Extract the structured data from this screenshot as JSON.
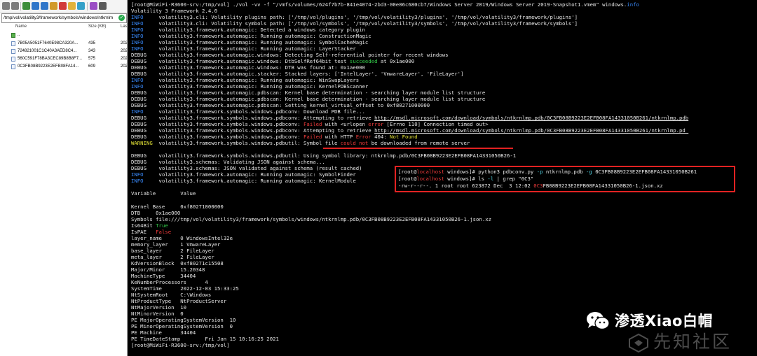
{
  "file_pane": {
    "path": "/tmp/vol/volatility3/framework/symbols/windows/ntkrnlm",
    "columns": {
      "name": "Name",
      "size": "Size (KB)",
      "last": "Las"
    },
    "files": [
      {
        "name": "..",
        "size": "",
        "last": ""
      },
      {
        "name": "7B05A5051F7640E98CA320A...",
        "size": "435",
        "last": "202"
      },
      {
        "name": "724821001C1C40A3AED8C4...",
        "size": "343",
        "last": "202"
      },
      {
        "name": "560C591F78BA3CEC89B8B8F7...",
        "size": "575",
        "last": "202"
      },
      {
        "name": "0C3FB08B9223E2EFB08FA14...",
        "size": "609",
        "last": "202"
      }
    ]
  },
  "terminal": {
    "lines": [
      [
        {
          "t": "[root@MiWiFi-R3600-srv:/tmp/vol] ./vol -vv -f \"/vmfs/volumes/624f7b7b-841e4074-2bd3-00e06c680cb7/Windows Server 2019/Windows Server 2019-Snapshot1.vmem\" windows."
        },
        {
          "t": "info",
          "c": "c-info"
        }
      ],
      [
        {
          "t": "Volatility 3 Framework 2.4.0"
        }
      ],
      [
        {
          "t": "INFO    ",
          "c": "c-info"
        },
        {
          "t": " volatility3.cli: Volatility plugins path: ['/tmp/vol/plugins', '/tmp/vol/volatility3/plugins', '/tmp/vol/volatility3/framework/plugins']"
        }
      ],
      [
        {
          "t": "INFO    ",
          "c": "c-info"
        },
        {
          "t": " volatility3.cli: Volatility symbols path: ['/tmp/vol/symbols', '/tmp/vol/volatility3/symbols', '/tmp/vol/volatility3/framework/symbols']"
        }
      ],
      [
        {
          "t": "INFO    ",
          "c": "c-info"
        },
        {
          "t": " volatility3.framework.automagic: Detected a windows category plugin"
        }
      ],
      [
        {
          "t": "INFO    ",
          "c": "c-info"
        },
        {
          "t": " volatility3.framework.automagic: Running automagic: ConstructionMagic"
        }
      ],
      [
        {
          "t": "INFO    ",
          "c": "c-info"
        },
        {
          "t": " volatility3.framework.automagic: Running automagic: SymbolCacheMagic"
        }
      ],
      [
        {
          "t": "INFO    ",
          "c": "c-info"
        },
        {
          "t": " volatility3.framework.automagic: Running automagic: LayerStacker"
        }
      ],
      [
        {
          "t": "DEBUG   "
        },
        {
          "t": " volatility3.framework.automagic.windows: Detecting Self-referential pointer for recent windows"
        }
      ],
      [
        {
          "t": "DEBUG   "
        },
        {
          "t": " volatility3.framework.automagic.windows: DtbSelfRef64bit test "
        },
        {
          "t": "succeeded",
          "c": "c-grn"
        },
        {
          "t": " at 0x1ae000"
        }
      ],
      [
        {
          "t": "DEBUG   "
        },
        {
          "t": " volatility3.framework.automagic.windows: DTB was found at: 0x1ae000"
        }
      ],
      [
        {
          "t": "DEBUG   "
        },
        {
          "t": " volatility3.framework.automagic.stacker: Stacked layers: ['IntelLayer', 'VmwareLayer', 'FileLayer']"
        }
      ],
      [
        {
          "t": "INFO    ",
          "c": "c-info"
        },
        {
          "t": " volatility3.framework.automagic: Running automagic: WinSwapLayers"
        }
      ],
      [
        {
          "t": "INFO    ",
          "c": "c-info"
        },
        {
          "t": " volatility3.framework.automagic: Running automagic: KernelPDBScanner"
        }
      ],
      [
        {
          "t": "DEBUG   "
        },
        {
          "t": " volatility3.framework.automagic.pdbscan: Kernel base determination - searching layer module list structure"
        }
      ],
      [
        {
          "t": "DEBUG   "
        },
        {
          "t": " volatility3.framework.automagic.pdbscan: Kernel base determination - searching layer module list structure"
        }
      ],
      [
        {
          "t": "DEBUG   "
        },
        {
          "t": " volatility3.framework.automagic.pdbscan: Setting kernel_virtual_offset to 0xf80271000000"
        }
      ],
      [
        {
          "t": "INFO    ",
          "c": "c-info"
        },
        {
          "t": " volatility3.framework.symbols.windows.pdbconv: Download PDB file..."
        }
      ],
      [
        {
          "t": "DEBUG   "
        },
        {
          "t": " volatility3.framework.symbols.windows.pdbconv: Attempting to retrieve "
        },
        {
          "t": "http://msdl.microsoft.com/download/symbols/ntkrnlmp.pdb/0C3FB08B9223E2EFB08FA14331050B261/ntkrnlmp.pdb",
          "c": "c-url"
        }
      ],
      [
        {
          "t": "DEBUG   "
        },
        {
          "t": " volatility3.framework.symbols.windows.pdbconv: "
        },
        {
          "t": "Failed",
          "c": "c-red"
        },
        {
          "t": " with <urlopen "
        },
        {
          "t": "error",
          "c": "c-red"
        },
        {
          "t": " [Errno 110] Connection timed out>"
        }
      ],
      [
        {
          "t": "DEBUG   "
        },
        {
          "t": " volatility3.framework.symbols.windows.pdbconv: Attempting to retrieve "
        },
        {
          "t": "http://msdl.microsoft.com/download/symbols/ntkrnlmp.pdb/0C3FB08B9223E2EFB08FA14331050B261/ntkrnlmp.pd_",
          "c": "c-url"
        }
      ],
      [
        {
          "t": "DEBUG   "
        },
        {
          "t": " volatility3.framework.symbols.windows.pdbconv: "
        },
        {
          "t": "Failed",
          "c": "c-red"
        },
        {
          "t": " with HTTP "
        },
        {
          "t": "Error",
          "c": "c-red"
        },
        {
          "t": " 404: "
        },
        {
          "t": "Not Found",
          "c": "c-yel"
        }
      ],
      [
        {
          "t": "WARNING ",
          "c": "c-yel"
        },
        {
          "t": " volatility3.framework.symbols.windows.pdbutil: Symbol file "
        },
        {
          "t": "could not",
          "c": "c-red"
        },
        {
          "t": " be downloaded from remote server"
        }
      ],
      [
        {
          "t": ""
        }
      ],
      [
        {
          "t": "DEBUG   "
        },
        {
          "t": " volatility3.framework.symbols.windows.pdbutil: Using symbol library: ntkrnlmp.pdb/0C3FB08B9223E2EFB08FA14331050B26-1"
        }
      ],
      [
        {
          "t": "DEBUG   "
        },
        {
          "t": " volatility3.schemas: Validating JSON against schema..."
        }
      ],
      [
        {
          "t": "DEBUG   "
        },
        {
          "t": " volatility3.schemas: JSON validated against schema (result cached)"
        }
      ],
      [
        {
          "t": "INFO    ",
          "c": "c-info"
        },
        {
          "t": " volatility3.framework.automagic: Running automagic: SymbolFinder"
        }
      ],
      [
        {
          "t": "INFO    ",
          "c": "c-info"
        },
        {
          "t": " volatility3.framework.automagic: Running automagic: KernelModule"
        }
      ],
      [
        {
          "t": ""
        }
      ],
      [
        {
          "t": "Variable        Value"
        }
      ],
      [
        {
          "t": ""
        }
      ],
      [
        {
          "t": "Kernel Base     0xf80271000000"
        }
      ],
      [
        {
          "t": "DTB     0x1ae000"
        }
      ],
      [
        {
          "t": "Symbols file:///tmp/vol/volatility3/framework/symbols/windows/ntkrnlmp.pdb/0C3FB08B9223E2EFB08FA14331050B26-1.json.xz"
        }
      ],
      [
        {
          "t": "Is64Bit "
        },
        {
          "t": "True",
          "c": "c-grn"
        }
      ],
      [
        {
          "t": "IsPAE   "
        },
        {
          "t": "False",
          "c": "c-red"
        }
      ],
      [
        {
          "t": "layer_name      0 WindowsIntel32e"
        }
      ],
      [
        {
          "t": "memory_layer    1 VmwareLayer"
        }
      ],
      [
        {
          "t": "base_layer      2 FileLayer"
        }
      ],
      [
        {
          "t": "meta_layer      2 FileLayer"
        }
      ],
      [
        {
          "t": "KdVersionBlock  0xf80271c15508"
        }
      ],
      [
        {
          "t": "Major/Minor     15.20348"
        }
      ],
      [
        {
          "t": "MachineType     34404"
        }
      ],
      [
        {
          "t": "KeNumberProcessors      4"
        }
      ],
      [
        {
          "t": "SystemTime      2022-12-03 15:33:25"
        }
      ],
      [
        {
          "t": "NtSystemRoot    C:\\Windows"
        }
      ],
      [
        {
          "t": "NtProductType   NtProductServer"
        }
      ],
      [
        {
          "t": "NtMajorVersion  10"
        }
      ],
      [
        {
          "t": "NtMinorVersion  0"
        }
      ],
      [
        {
          "t": "PE MajorOperatingSystemVersion  10"
        }
      ],
      [
        {
          "t": "PE MinorOperatingSystemVersion  0"
        }
      ],
      [
        {
          "t": "PE Machine      34404"
        }
      ],
      [
        {
          "t": "PE TimeDateStamp        Fri Jan 15 10:16:25 2021"
        }
      ],
      [
        {
          "t": "[root@MiWiFi-R3600-srv:/tmp/vol]"
        }
      ]
    ],
    "popup": [
      [
        {
          "t": "[root@"
        },
        {
          "t": "localhost",
          "c": "c-red"
        },
        {
          "t": " windows]# python3 pdbconv.py "
        },
        {
          "t": "-p",
          "c": "c-cyan"
        },
        {
          "t": " ntkrnlmp.pdb "
        },
        {
          "t": "-g",
          "c": "c-cyan"
        },
        {
          "t": " 0C3FB08B9223E2EFB08FA14331050B261"
        }
      ],
      [
        {
          "t": "[root@"
        },
        {
          "t": "localhost",
          "c": "c-red"
        },
        {
          "t": " windows]# ls "
        },
        {
          "t": "-l",
          "c": "c-cyan"
        },
        {
          "t": " | grep \"0C3\""
        }
      ],
      [
        {
          "t": "-rw-r--r--. 1 root root 623872 Dec  3 12:02 "
        },
        {
          "t": "0C3",
          "c": "c-red"
        },
        {
          "t": "FB08B9223E2EFB08FA14331050B26-1.json.xz"
        }
      ]
    ]
  },
  "watermark": {
    "title": "渗透Xiao白帽",
    "site": "先知社区"
  },
  "colors": {
    "info": "#3a8cff",
    "error": "#ef3b3b",
    "warning": "#e5e537",
    "success": "#34cc4a",
    "highlight_box": "#e22222"
  }
}
